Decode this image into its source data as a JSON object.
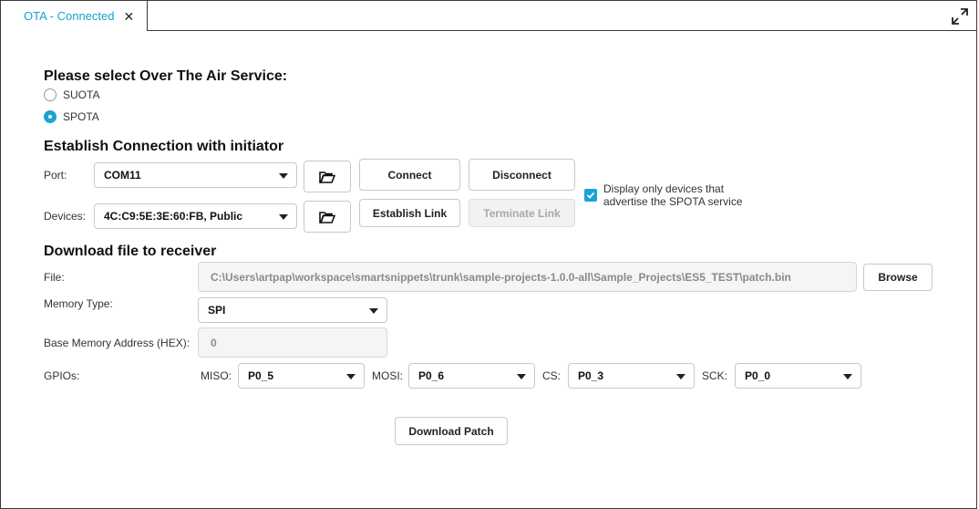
{
  "tab": {
    "label": "OTA - Connected",
    "close": "✕"
  },
  "service": {
    "heading": "Please select Over The Air Service:",
    "options": [
      {
        "label": "SUOTA",
        "selected": false
      },
      {
        "label": "SPOTA",
        "selected": true
      }
    ]
  },
  "connection": {
    "heading": "Establish Connection with initiator",
    "port_label": "Port:",
    "port_value": "COM11",
    "devices_label": "Devices:",
    "devices_value": "4C:C9:5E:3E:60:FB, Public",
    "connect_label": "Connect",
    "disconnect_label": "Disconnect",
    "establish_label": "Establish Link",
    "terminate_label": "Terminate Link",
    "filter_checked": true,
    "filter_line1": "Display only devices that",
    "filter_line2": "advertise the SPOTA service"
  },
  "download": {
    "heading": "Download file to receiver",
    "file_label": "File:",
    "file_value": "C:\\Users\\artpap\\workspace\\smartsnippets\\trunk\\sample-projects-1.0.0-all\\Sample_Projects\\ES5_TEST\\patch.bin",
    "browse_label": "Browse",
    "memory_label": "Memory Type:",
    "memory_value": "SPI",
    "base_label": "Base Memory Address (HEX):",
    "base_value": "0",
    "gpios_label": "GPIOs:",
    "miso_label": "MISO:",
    "miso_value": "P0_5",
    "mosi_label": "MOSI:",
    "mosi_value": "P0_6",
    "cs_label": "CS:",
    "cs_value": "P0_3",
    "sck_label": "SCK:",
    "sck_value": "P0_0",
    "download_label": "Download Patch"
  },
  "colors": {
    "accent": "#1aa3d6",
    "border": "#3a3a3a"
  },
  "icons": {
    "tab_close": "close-icon",
    "maximize": "maximize-icon",
    "folder": "folder-open-icon",
    "dropdown": "chevron-down-icon"
  }
}
